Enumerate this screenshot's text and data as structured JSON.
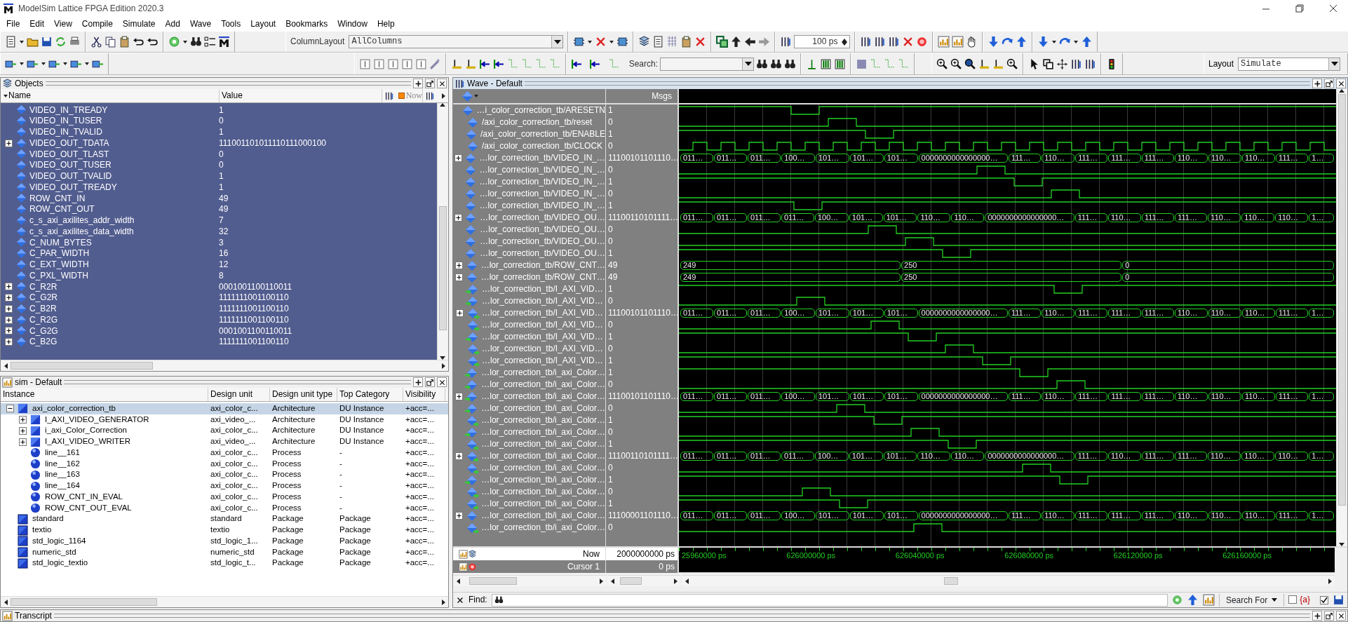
{
  "window": {
    "title": "ModelSim Lattice FPGA Edition 2020.3"
  },
  "menu": [
    "File",
    "Edit",
    "View",
    "Compile",
    "Simulate",
    "Add",
    "Wave",
    "Tools",
    "Layout",
    "Bookmarks",
    "Window",
    "Help"
  ],
  "toolbar": {
    "column_layout_label": "ColumnLayout",
    "column_layout_value": "AllColumns",
    "time_step": "100 ps",
    "search_label": "Search:",
    "layout_label": "Layout",
    "layout_value": "Simulate"
  },
  "objects": {
    "title": "Objects",
    "columns": [
      "Name",
      "Value"
    ],
    "now_label": "Now",
    "rows": [
      {
        "name": "VIDEO_IN_TREADY",
        "value": "1",
        "expandable": false
      },
      {
        "name": "VIDEO_IN_TUSER",
        "value": "0",
        "expandable": false
      },
      {
        "name": "VIDEO_IN_TVALID",
        "value": "1",
        "expandable": false
      },
      {
        "name": "VIDEO_OUT_TDATA",
        "value": "111001101011110111000100",
        "expandable": true
      },
      {
        "name": "VIDEO_OUT_TLAST",
        "value": "0",
        "expandable": false
      },
      {
        "name": "VIDEO_OUT_TUSER",
        "value": "0",
        "expandable": false
      },
      {
        "name": "VIDEO_OUT_TVALID",
        "value": "1",
        "expandable": false
      },
      {
        "name": "VIDEO_OUT_TREADY",
        "value": "1",
        "expandable": false
      },
      {
        "name": "ROW_CNT_IN",
        "value": "49",
        "expandable": false
      },
      {
        "name": "ROW_CNT_OUT",
        "value": "49",
        "expandable": false
      },
      {
        "name": "c_s_axi_axilites_addr_width",
        "value": "7",
        "expandable": false
      },
      {
        "name": "c_s_axi_axilites_data_width",
        "value": "32",
        "expandable": false
      },
      {
        "name": "C_NUM_BYTES",
        "value": "3",
        "expandable": false
      },
      {
        "name": "C_PAR_WIDTH",
        "value": "16",
        "expandable": false
      },
      {
        "name": "C_EXT_WIDTH",
        "value": "12",
        "expandable": false
      },
      {
        "name": "C_PXL_WIDTH",
        "value": "8",
        "expandable": false
      },
      {
        "name": "C_R2R",
        "value": "0001001100110011",
        "expandable": true
      },
      {
        "name": "C_G2R",
        "value": "1111111001100110",
        "expandable": true
      },
      {
        "name": "C_B2R",
        "value": "1111111001100110",
        "expandable": true
      },
      {
        "name": "C_R2G",
        "value": "1111111001100110",
        "expandable": true
      },
      {
        "name": "C_G2G",
        "value": "0001001100110011",
        "expandable": true
      },
      {
        "name": "C_B2G",
        "value": "1111111001100110",
        "expandable": true
      }
    ]
  },
  "sim": {
    "title": "sim - Default",
    "columns": [
      "Instance",
      "Design unit",
      "Design unit type",
      "Top Category",
      "Visibility"
    ],
    "rows": [
      {
        "instance": "axi_color_correction_tb",
        "design_unit": "axi_color_c...",
        "type": "Architecture",
        "category": "DU Instance",
        "visibility": "+acc=...",
        "kind": "architecture",
        "expandable": true,
        "expanded": true,
        "selected": true,
        "children": [
          {
            "instance": "I_AXI_VIDEO_GENERATOR",
            "design_unit": "axi_video_...",
            "type": "Architecture",
            "category": "DU Instance",
            "visibility": "+acc=...",
            "kind": "architecture",
            "expandable": true,
            "expanded": false,
            "selected": false
          },
          {
            "instance": "i_axi_Color_Correction",
            "design_unit": "axi_color_c...",
            "type": "Architecture",
            "category": "DU Instance",
            "visibility": "+acc=...",
            "kind": "architecture",
            "expandable": true,
            "expanded": false,
            "selected": false
          },
          {
            "instance": "I_AXI_VIDEO_WRITER",
            "design_unit": "axi_video_...",
            "type": "Architecture",
            "category": "DU Instance",
            "visibility": "+acc=...",
            "kind": "architecture",
            "expandable": true,
            "expanded": false,
            "selected": false
          },
          {
            "instance": "line__161",
            "design_unit": "axi_color_c...",
            "type": "Process",
            "category": "-",
            "visibility": "+acc=...",
            "kind": "process",
            "expandable": false,
            "expanded": false,
            "selected": false
          },
          {
            "instance": "line__162",
            "design_unit": "axi_color_c...",
            "type": "Process",
            "category": "-",
            "visibility": "+acc=...",
            "kind": "process",
            "expandable": false,
            "expanded": false,
            "selected": false
          },
          {
            "instance": "line__163",
            "design_unit": "axi_color_c...",
            "type": "Process",
            "category": "-",
            "visibility": "+acc=...",
            "kind": "process",
            "expandable": false,
            "expanded": false,
            "selected": false
          },
          {
            "instance": "line__164",
            "design_unit": "axi_color_c...",
            "type": "Process",
            "category": "-",
            "visibility": "+acc=...",
            "kind": "process",
            "expandable": false,
            "expanded": false,
            "selected": false
          },
          {
            "instance": "ROW_CNT_IN_EVAL",
            "design_unit": "axi_color_c...",
            "type": "Process",
            "category": "-",
            "visibility": "+acc=...",
            "kind": "process",
            "expandable": false,
            "expanded": false,
            "selected": false
          },
          {
            "instance": "ROW_CNT_OUT_EVAL",
            "design_unit": "axi_color_c...",
            "type": "Process",
            "category": "-",
            "visibility": "+acc=...",
            "kind": "process",
            "expandable": false,
            "expanded": false,
            "selected": false
          }
        ]
      },
      {
        "instance": "standard",
        "design_unit": "standard",
        "type": "Package",
        "category": "Package",
        "visibility": "+acc=...",
        "kind": "package",
        "expandable": false,
        "expanded": false,
        "selected": false
      },
      {
        "instance": "textio",
        "design_unit": "textio",
        "type": "Package",
        "category": "Package",
        "visibility": "+acc=...",
        "kind": "package",
        "expandable": false,
        "expanded": false,
        "selected": false
      },
      {
        "instance": "std_logic_1164",
        "design_unit": "std_logic_1...",
        "type": "Package",
        "category": "Package",
        "visibility": "+acc=...",
        "kind": "package",
        "expandable": false,
        "expanded": false,
        "selected": false
      },
      {
        "instance": "numeric_std",
        "design_unit": "numeric_std",
        "type": "Package",
        "category": "Package",
        "visibility": "+acc=...",
        "kind": "package",
        "expandable": false,
        "expanded": false,
        "selected": false
      },
      {
        "instance": "std_logic_textio",
        "design_unit": "std_logic_t...",
        "type": "Package",
        "category": "Package",
        "visibility": "+acc=...",
        "kind": "package",
        "expandable": false,
        "expanded": false,
        "selected": false
      }
    ]
  },
  "wave": {
    "title": "Wave - Default",
    "msgs_label": "Msgs",
    "signals": [
      {
        "name": "…i_color_correction_tb/ARESETN",
        "value": "1",
        "kind": "bit",
        "port_in": false,
        "port_out": false
      },
      {
        "name": "/axi_color_correction_tb/reset",
        "value": "0",
        "kind": "bit",
        "port_in": false,
        "port_out": false
      },
      {
        "name": "/axi_color_correction_tb/ENABLE",
        "value": "1",
        "kind": "bit",
        "port_in": false,
        "port_out": false
      },
      {
        "name": "/axi_color_correction_tb/CLOCK",
        "value": "0",
        "kind": "clock",
        "port_in": false,
        "port_out": false
      },
      {
        "name": "…lor_correction_tb/VIDEO_IN_…",
        "value": "11100101101110…",
        "kind": "bus",
        "port_in": false,
        "port_out": false,
        "segments": [
          "011…",
          "011…",
          "011…",
          "100…",
          "101…",
          "101…",
          "101…",
          "0000000000000000…",
          "111…",
          "110…",
          "111…",
          "111…",
          "111…",
          "110…",
          "110…",
          "110…",
          "111…",
          "1…"
        ]
      },
      {
        "name": "…lor_correction_tb/VIDEO_IN_…",
        "value": "0",
        "kind": "bit",
        "port_in": false,
        "port_out": false
      },
      {
        "name": "…lor_correction_tb/VIDEO_IN_…",
        "value": "1",
        "kind": "bit",
        "port_in": false,
        "port_out": false
      },
      {
        "name": "…lor_correction_tb/VIDEO_IN_…",
        "value": "0",
        "kind": "bit",
        "port_in": false,
        "port_out": false
      },
      {
        "name": "…lor_correction_tb/VIDEO_IN_…",
        "value": "1",
        "kind": "bit",
        "port_in": false,
        "port_out": false
      },
      {
        "name": "…lor_correction_tb/VIDEO_OU…",
        "value": "11100110101111…",
        "kind": "bus",
        "port_in": false,
        "port_out": false,
        "segments": [
          "011…",
          "011…",
          "011…",
          "011…",
          "100…",
          "101…",
          "101…",
          "110…",
          "110…",
          "0000000000000000…",
          "111…",
          "110…",
          "111…",
          "111…",
          "110…",
          "110…",
          "110…",
          "1…"
        ]
      },
      {
        "name": "…lor_correction_tb/VIDEO_OU…",
        "value": "0",
        "kind": "bit",
        "port_in": false,
        "port_out": false
      },
      {
        "name": "…lor_correction_tb/VIDEO_OU…",
        "value": "0",
        "kind": "bit",
        "port_in": false,
        "port_out": false
      },
      {
        "name": "…lor_correction_tb/VIDEO_OU…",
        "value": "1",
        "kind": "bit",
        "port_in": false,
        "port_out": false
      },
      {
        "name": "…lor_correction_tb/ROW_CNT…",
        "value": "49",
        "kind": "bus",
        "port_in": false,
        "port_out": false,
        "segments": [
          "249",
          "250",
          "0"
        ]
      },
      {
        "name": "…lor_correction_tb/ROW_CNT…",
        "value": "49",
        "kind": "bus",
        "port_in": false,
        "port_out": false,
        "segments": [
          "249",
          "250",
          "0"
        ]
      },
      {
        "name": "…lor_correction_tb/I_AXI_VID…",
        "value": "1",
        "kind": "bit",
        "port_in": true,
        "port_out": false
      },
      {
        "name": "…lor_correction_tb/I_AXI_VID…",
        "value": "0",
        "kind": "bit",
        "port_in": true,
        "port_out": false
      },
      {
        "name": "…lor_correction_tb/I_AXI_VID…",
        "value": "11100101101110…",
        "kind": "bus",
        "port_in": false,
        "port_out": true,
        "segments": [
          "011…",
          "011…",
          "011…",
          "100…",
          "101…",
          "101…",
          "101…",
          "0000000000000000…",
          "111…",
          "110…",
          "111…",
          "111…",
          "111…",
          "110…",
          "110…",
          "110…",
          "111…",
          "1…"
        ]
      },
      {
        "name": "…lor_correction_tb/I_AXI_VID…",
        "value": "0",
        "kind": "bit",
        "port_in": false,
        "port_out": true
      },
      {
        "name": "…lor_correction_tb/I_AXI_VID…",
        "value": "1",
        "kind": "bit",
        "port_in": true,
        "port_out": false
      },
      {
        "name": "…lor_correction_tb/I_AXI_VID…",
        "value": "0",
        "kind": "bit",
        "port_in": false,
        "port_out": true
      },
      {
        "name": "…lor_correction_tb/I_AXI_VID…",
        "value": "1",
        "kind": "bit",
        "port_in": false,
        "port_out": true
      },
      {
        "name": "…lor_correction_tb/i_axi_Color…",
        "value": "1",
        "kind": "bit",
        "port_in": true,
        "port_out": false
      },
      {
        "name": "…lor_correction_tb/i_axi_Color…",
        "value": "0",
        "kind": "bit",
        "port_in": true,
        "port_out": false
      },
      {
        "name": "…lor_correction_tb/i_axi_Color…",
        "value": "11100101101110…",
        "kind": "bus",
        "port_in": true,
        "port_out": false,
        "segments": [
          "011…",
          "011…",
          "011…",
          "100…",
          "101…",
          "101…",
          "101…",
          "0000000000000000…",
          "111…",
          "110…",
          "111…",
          "111…",
          "111…",
          "110…",
          "110…",
          "110…",
          "111…",
          "1…"
        ]
      },
      {
        "name": "…lor_correction_tb/i_axi_Color…",
        "value": "0",
        "kind": "bit",
        "port_in": true,
        "port_out": false
      },
      {
        "name": "…lor_correction_tb/i_axi_Color…",
        "value": "1",
        "kind": "bit",
        "port_in": false,
        "port_out": true
      },
      {
        "name": "…lor_correction_tb/i_axi_Color…",
        "value": "0",
        "kind": "bit",
        "port_in": true,
        "port_out": false
      },
      {
        "name": "…lor_correction_tb/i_axi_Color…",
        "value": "1",
        "kind": "bit",
        "port_in": false,
        "port_out": true
      },
      {
        "name": "…lor_correction_tb/i_axi_Color…",
        "value": "11100110101111…",
        "kind": "bus",
        "port_in": false,
        "port_out": true,
        "segments": [
          "011…",
          "011…",
          "011…",
          "011…",
          "100…",
          "101…",
          "101…",
          "110…",
          "110…",
          "0000000000000000…",
          "111…",
          "110…",
          "111…",
          "111…",
          "110…",
          "110…",
          "110…",
          "1…"
        ]
      },
      {
        "name": "…lor_correction_tb/i_axi_Color…",
        "value": "0",
        "kind": "bit",
        "port_in": false,
        "port_out": true
      },
      {
        "name": "…lor_correction_tb/i_axi_Color…",
        "value": "1",
        "kind": "bit",
        "port_in": true,
        "port_out": false
      },
      {
        "name": "…lor_correction_tb/i_axi_Color…",
        "value": "0",
        "kind": "bit",
        "port_in": false,
        "port_out": true
      },
      {
        "name": "…lor_correction_tb/i_axi_Color…",
        "value": "1",
        "kind": "bit",
        "port_in": false,
        "port_out": true
      },
      {
        "name": "…lor_correction_tb/i_axi_Color…",
        "value": "11100001101110…",
        "kind": "bus",
        "port_in": false,
        "port_out": false,
        "segments": [
          "011…",
          "011…",
          "011…",
          "100…",
          "101…",
          "101…",
          "101…",
          "0000000000000000…",
          "111…",
          "110…",
          "111…",
          "111…",
          "111…",
          "110…",
          "110…",
          "110…",
          "111…",
          "1…"
        ]
      },
      {
        "name": "…lor_correction_tb/i_axi_Color…",
        "value": "0",
        "kind": "bit",
        "port_in": false,
        "port_out": true
      }
    ],
    "now_label": "Now",
    "now_value": "2000000000 ps",
    "cursor_label": "Cursor 1",
    "cursor_value": "0 ps",
    "time_labels": [
      "25960000 ps",
      "626000000 ps",
      "626040000 ps",
      "626080000 ps",
      "626120000 ps",
      "626160000 ps"
    ],
    "find_label": "Find:",
    "search_for": "Search For",
    "regex_label": "{a}",
    "regex_checked": false,
    "extra_checked": true
  },
  "transcript": {
    "title": "Transcript"
  }
}
